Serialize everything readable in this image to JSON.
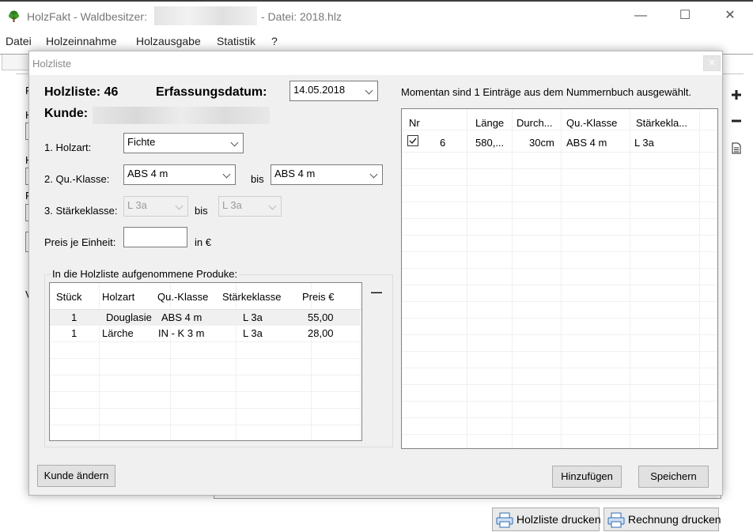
{
  "window": {
    "title_prefix": "HolzFakt - Waldbesitzer:",
    "title_file": "- Datei: 2018.hlz",
    "minimize": "—",
    "maximize": "☐",
    "close": "✕"
  },
  "menu": [
    "Datei",
    "Holzeinnahme",
    "Holzausgabe",
    "Statistik",
    "?"
  ],
  "background": {
    "side_letters": [
      "F",
      "H",
      "H",
      "F",
      "V"
    ],
    "icons": [
      "plus-icon",
      "minus-icon",
      "document-icon"
    ],
    "buttons": {
      "print_list": "Holzliste drucken",
      "print_invoice": "Rechnung drucken"
    }
  },
  "dialog": {
    "title": "Holzliste",
    "list_label": "Holzliste: 46",
    "date_label": "Erfassungsdatum:",
    "date_value": "14.05.2018",
    "customer_label": "Kunde:",
    "form": {
      "wood_type_label": "1. Holzart:",
      "wood_type_value": "Fichte",
      "quality_label": "2. Qu.-Klasse:",
      "quality_from": "ABS 4 m",
      "bis1": "bis",
      "quality_to": "ABS 4 m",
      "strength_label": "3. Stärkeklasse:",
      "strength_from": "L 3a",
      "bis2": "bis",
      "strength_to": "L 3a",
      "price_label": "Preis je Einheit:",
      "price_value": "",
      "currency": "in €"
    },
    "products": {
      "group_label": "In die Holzliste aufgenommene Produke:",
      "headers": [
        "Stück",
        "Holzart",
        "Qu.-Klasse",
        "Stärkeklasse",
        "Preis €"
      ],
      "rows": [
        [
          "1",
          "Douglasie",
          "ABS 4 m",
          "L 3a",
          "55,00"
        ],
        [
          "1",
          "Lärche",
          "IN - K 3 m",
          "L 3a",
          "28,00"
        ]
      ],
      "remove_symbol": "—"
    },
    "info": "Momentan sind  1   Einträge aus dem Nummernbuch ausgewählt.",
    "entries": {
      "headers": [
        "Nr",
        "Länge",
        "Durch...",
        "Qu.-Klasse",
        "Stärkekla..."
      ],
      "rows": [
        {
          "checked": true,
          "nr": "6",
          "length": "580,...",
          "diameter": "30cm",
          "quality": "ABS 4 m",
          "strength": "L 3a"
        }
      ]
    },
    "buttons": {
      "change_customer": "Kunde ändern",
      "add": "Hinzufügen",
      "save": "Speichern"
    }
  }
}
